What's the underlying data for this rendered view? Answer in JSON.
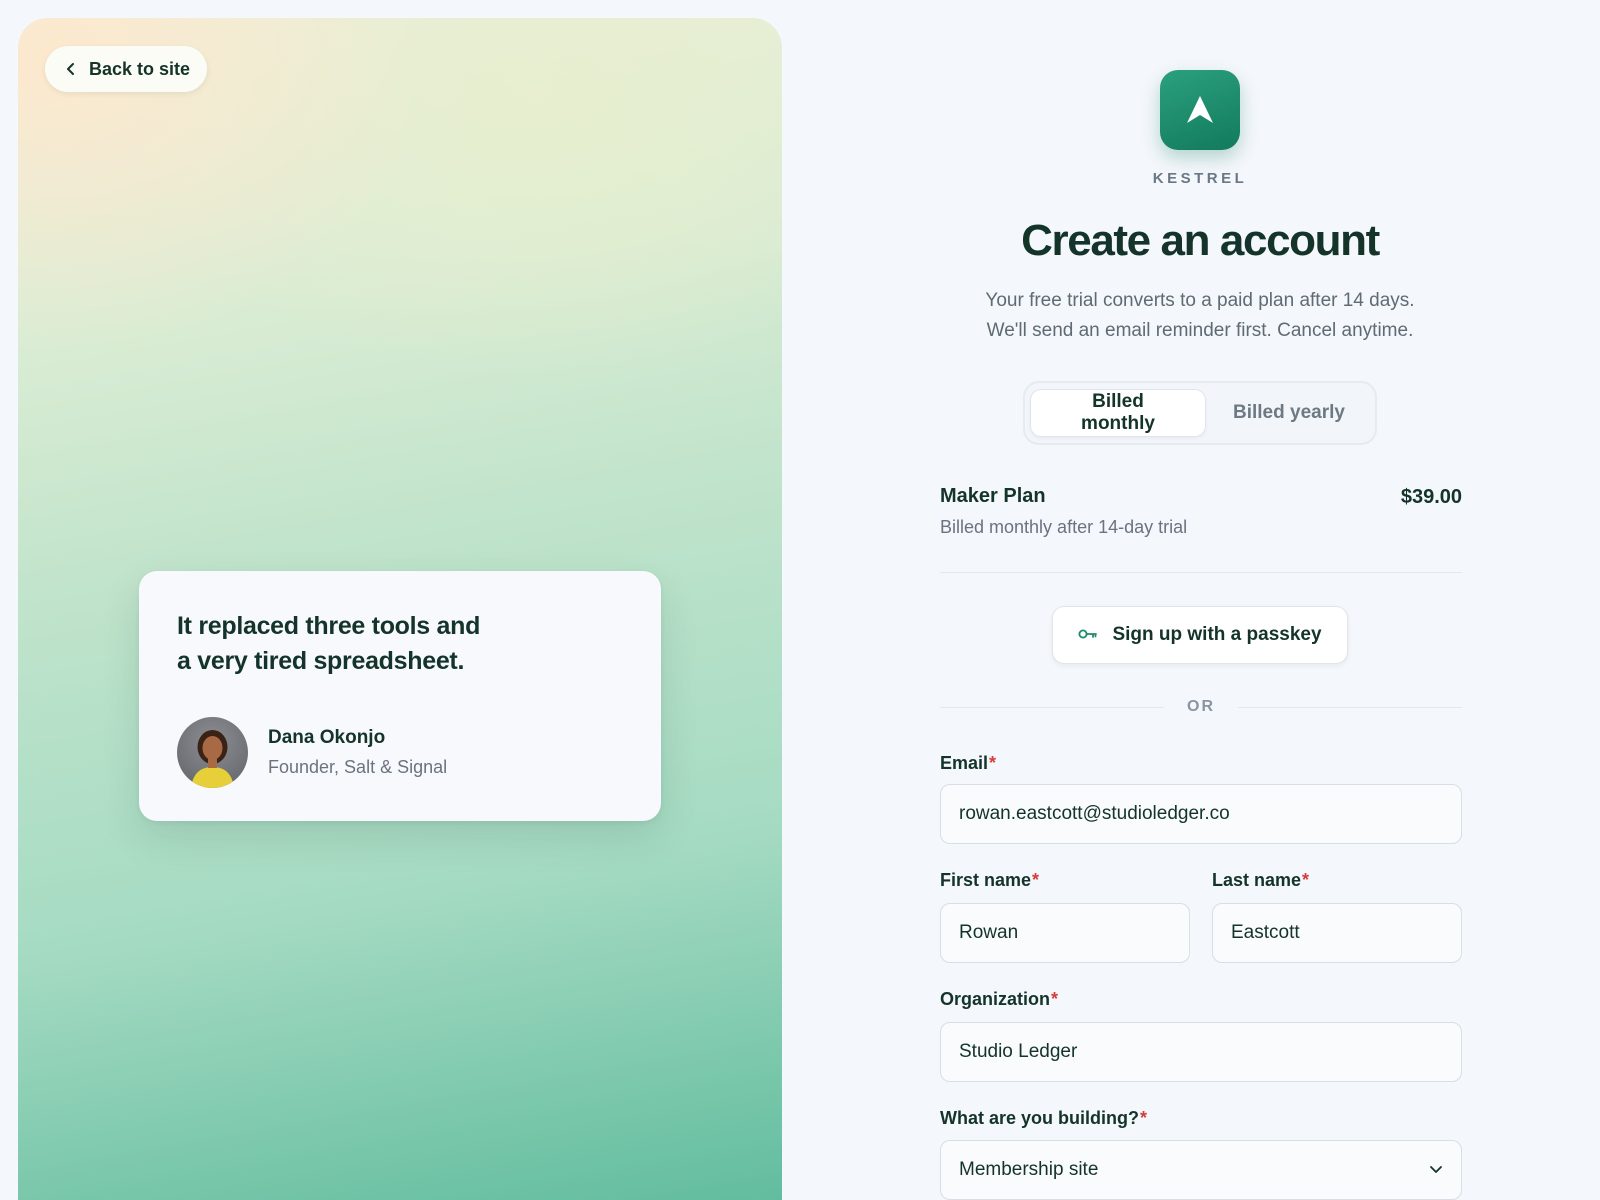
{
  "hero": {
    "back_label": "Back to site",
    "testimonial": {
      "quote_line1": "It replaced three tools and",
      "quote_line2": "a very tired spreadsheet.",
      "author_name": "Dana Okonjo",
      "author_role": "Founder, Salt & Signal"
    }
  },
  "brand": {
    "name": "KESTREL",
    "accent": "#1f8a6b"
  },
  "form": {
    "title": "Create an account",
    "subtitle_line1": "Your free trial converts to a paid plan after 14 days.",
    "subtitle_line2": "We'll send an email reminder first. Cancel anytime.",
    "billing": {
      "options": [
        "Billed monthly",
        "Billed yearly"
      ],
      "selected": "Billed monthly"
    },
    "plan": {
      "name": "Maker Plan",
      "price": "$39.00",
      "note": "Billed monthly after 14-day trial"
    },
    "passkey_label": "Sign up with a passkey",
    "or_label": "OR",
    "fields": {
      "email": {
        "label": "Email",
        "value": "rowan.eastcott@studioledger.co"
      },
      "first_name": {
        "label": "First name",
        "value": "Rowan"
      },
      "last_name": {
        "label": "Last name",
        "value": "Eastcott"
      },
      "organization": {
        "label": "Organization",
        "value": "Studio Ledger"
      },
      "building": {
        "label": "What are you building?",
        "value": "Membership site"
      }
    },
    "required_mark": "*"
  }
}
